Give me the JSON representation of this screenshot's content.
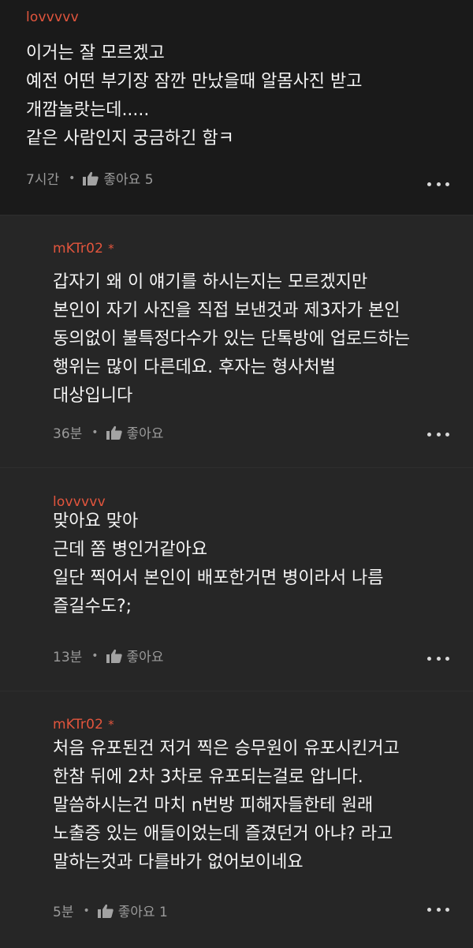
{
  "comments": [
    {
      "author": "lovvvvv",
      "badge": "",
      "text": "이거는 잘 모르겠고\n예전 어떤 부기장 잠깐 만났을때 알몸사진 받고\n개깜놀랏는데.....\n같은 사람인지 궁금하긴 함ㅋ",
      "time": "7시간",
      "like_label": "좋아요 5"
    },
    {
      "author": "mKTr02",
      "badge": "*",
      "text": "갑자기 왜 이 얘기를 하시는지는 모르겠지만\n본인이 자기 사진을 직접 보낸것과 제3자가 본인\n동의없이 불특정다수가 있는 단톡방에 업로드하는\n행위는 많이 다른데요. 후자는 형사처벌\n대상입니다",
      "time": "36분",
      "like_label": "좋아요"
    },
    {
      "author": "lovvvvv",
      "badge": "",
      "text": "맞아요 맞아\n근데 쫌 병인거같아요\n일단 찍어서 본인이 배포한거면 병이라서 나름\n즐길수도?;",
      "time": "13분",
      "like_label": "좋아요"
    },
    {
      "author": "mKTr02",
      "badge": "*",
      "text": "처음 유포된건 저거 찍은 승무원이 유포시킨거고\n한참 뒤에 2차 3차로 유포되는걸로 압니다.\n말씀하시는건 마치 n번방 피해자들한테 원래\n노출증 있는 애들이었는데 즐겼던거 아냐? 라고\n말하는것과 다를바가 없어보이네요",
      "time": "5분",
      "like_label": "좋아요 1"
    }
  ],
  "icons": {
    "like": "thumbs-up-icon",
    "more": "more-horizontal-icon"
  },
  "colors": {
    "author": "#e2553d",
    "background": "#1a1a1a",
    "reply_background": "#262626"
  }
}
